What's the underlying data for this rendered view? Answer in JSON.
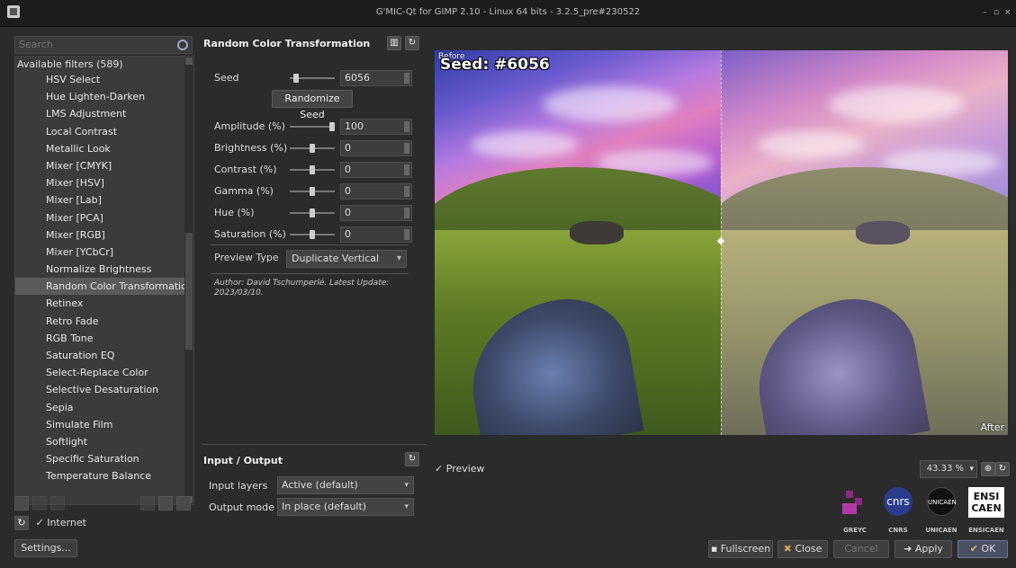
{
  "window": {
    "title": "G'MIC-Qt for GIMP 2.10 - Linux 64 bits - 3.2.5_pre#230522",
    "controls": [
      "–",
      "▫",
      "×"
    ]
  },
  "left": {
    "search_placeholder": "Search",
    "filters_header": "Available filters (589)",
    "filters": [
      "HSV Select",
      "Hue Lighten-Darken",
      "LMS Adjustment",
      "Local Contrast",
      "Metallic Look",
      "Mixer [CMYK]",
      "Mixer [HSV]",
      "Mixer [Lab]",
      "Mixer [PCA]",
      "Mixer [RGB]",
      "Mixer [YCbCr]",
      "Normalize Brightness",
      "Random Color Transformation",
      "Retinex",
      "Retro Fade",
      "RGB Tone",
      "Saturation EQ",
      "Select-Replace Color",
      "Selective Desaturation",
      "Sepia",
      "Simulate Film",
      "Softlight",
      "Specific Saturation",
      "Temperature Balance"
    ],
    "selected_index": 12,
    "internet_label": "Internet",
    "settings_label": "Settings..."
  },
  "filter": {
    "title": "Random Color Transformation",
    "seed": {
      "label": "Seed",
      "value": "6056",
      "slider": 0.1
    },
    "randomize_label": "Randomize Seed",
    "params": [
      {
        "label": "Amplitude (%)",
        "value": "100",
        "slider": 1.0
      },
      {
        "label": "Brightness (%)",
        "value": "0",
        "slider": 0.5
      },
      {
        "label": "Contrast (%)",
        "value": "0",
        "slider": 0.5
      },
      {
        "label": "Gamma (%)",
        "value": "0",
        "slider": 0.5
      },
      {
        "label": "Hue (%)",
        "value": "0",
        "slider": 0.5
      },
      {
        "label": "Saturation (%)",
        "value": "0",
        "slider": 0.5
      }
    ],
    "preview_type_label": "Preview Type",
    "preview_type_value": "Duplicate Vertical",
    "author_line": "Author: David Tschumperlé.    Latest Update: 2023/03/10."
  },
  "io": {
    "title": "Input / Output",
    "input_label": "Input layers",
    "input_value": "Active (default)",
    "output_label": "Output mode",
    "output_value": "In place (default)"
  },
  "preview": {
    "before_label": "Before",
    "after_label": "After",
    "seed_overlay": "Seed: #6056",
    "checkbox_label": "Preview",
    "zoom_value": "43.33 %"
  },
  "logos": [
    {
      "name": "GREYC",
      "color": "#8b2a84"
    },
    {
      "name": "CNRS",
      "color": "#2a3c8b"
    },
    {
      "name": "UNICAEN",
      "color": "#111111"
    },
    {
      "name": "ENSICAEN",
      "color": "#ffffff"
    }
  ],
  "buttons": {
    "fullscreen": "Fullscreen",
    "close": "Close",
    "cancel": "Cancel",
    "apply": "Apply",
    "ok": "OK"
  }
}
